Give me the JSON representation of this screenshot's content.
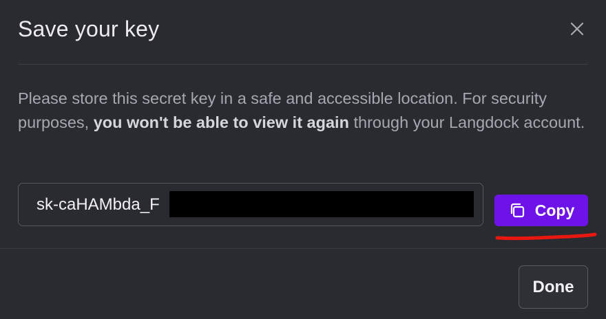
{
  "dialog": {
    "title": "Save your key",
    "description": {
      "before": "Please store this secret key in a safe and accessible location. For security purposes, ",
      "bold": "you won't be able to view it again",
      "after": " through your Langdock account."
    },
    "key_value": "sk-caHAMbda_F",
    "copy_label": "Copy",
    "done_label": "Done",
    "close_icon": "close-icon",
    "copy_icon": "copy-icon"
  },
  "colors": {
    "background": "#2a2b31",
    "accent": "#6d12e8",
    "annotation": "#e8170f"
  }
}
